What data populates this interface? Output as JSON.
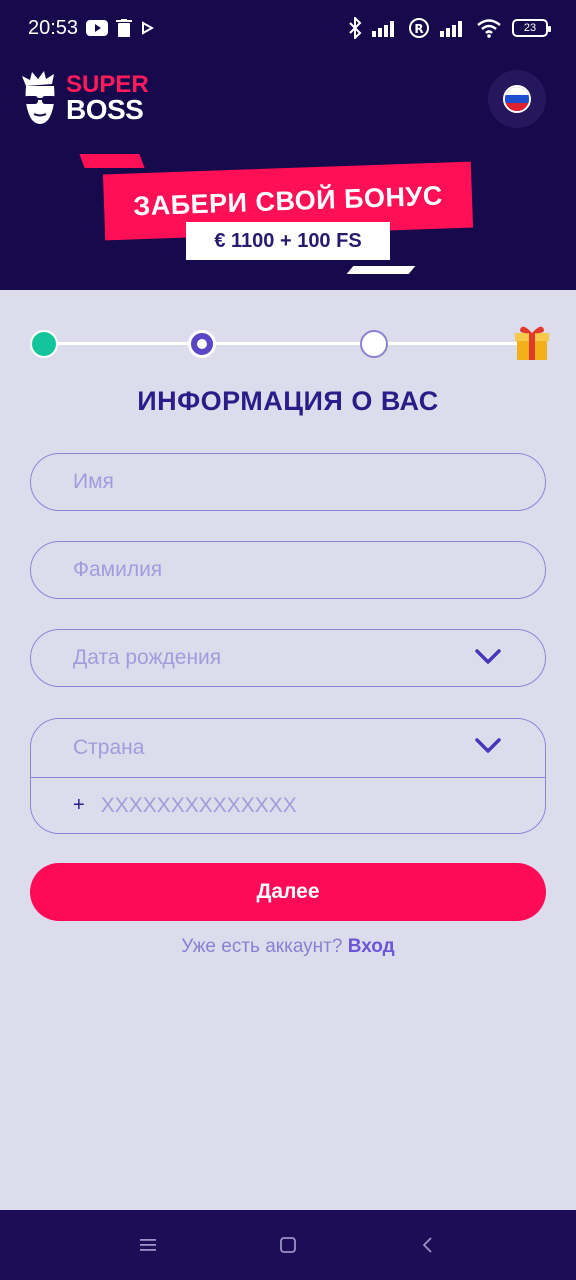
{
  "status_bar": {
    "time": "20:53",
    "battery": "23",
    "icons": [
      "youtube-icon",
      "trash-icon",
      "play-icon",
      "bluetooth-icon",
      "signal-icon",
      "registered-icon",
      "signal-icon",
      "wifi-icon",
      "battery-icon"
    ]
  },
  "header": {
    "logo_super": "SUPER",
    "logo_boss": "BOSS",
    "language_flag": "russia-flag-icon"
  },
  "banner": {
    "title": "ЗАБЕРИ СВОЙ БОНУС",
    "subtitle": "€ 1100 + 100 FS"
  },
  "stepper": {
    "steps": [
      "done",
      "current",
      "pending"
    ],
    "final_icon": "gift-icon"
  },
  "form": {
    "title": "ИНФОРМАЦИЯ О ВАС",
    "first_name_placeholder": "Имя",
    "last_name_placeholder": "Фамилия",
    "birthdate_placeholder": "Дата рождения",
    "country_placeholder": "Страна",
    "phone_prefix": "+",
    "phone_placeholder": "XXXXXXXXXXXXXX",
    "next_label": "Далее",
    "has_account_text": "Уже есть аккаунт?",
    "login_label": "Вход"
  },
  "colors": {
    "header_bg": "#160a4d",
    "accent_pink": "#ff0a57",
    "page_bg": "#dddcec",
    "title_purple": "#2c1c87",
    "step_done": "#14c49c"
  }
}
